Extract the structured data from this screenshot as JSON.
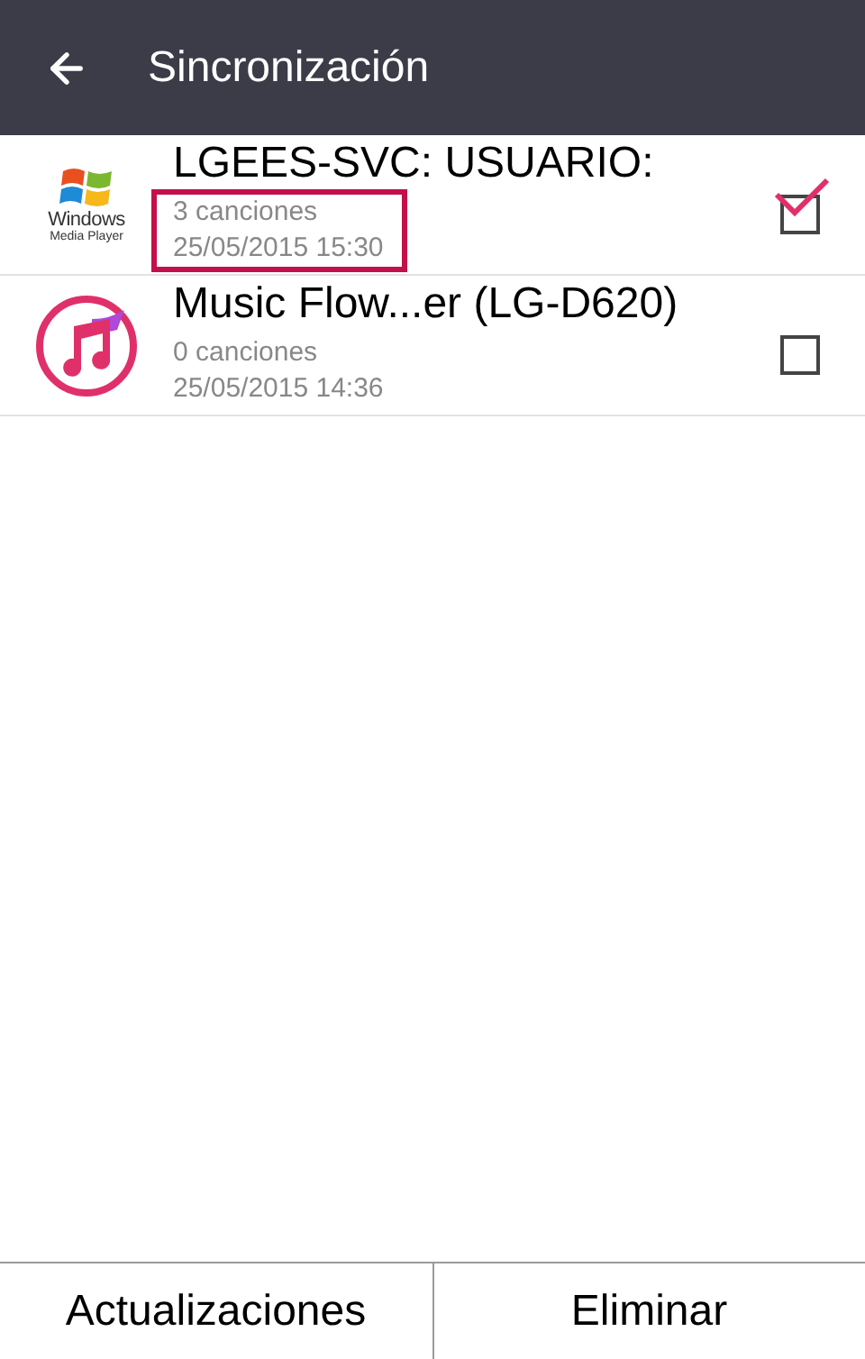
{
  "header": {
    "title": "Sincronización"
  },
  "items": [
    {
      "kind": "wmp",
      "logo_lines": [
        "Windows",
        "Media Player"
      ],
      "name": "LGEES-SVC: USUARIO:",
      "count": "3 canciones",
      "date": "25/05/2015 15:30",
      "checked": true,
      "highlighted": true
    },
    {
      "kind": "music",
      "name": "Music Flow...er (LG-D620)",
      "count": "0 canciones",
      "date": "25/05/2015 14:36",
      "checked": false,
      "highlighted": false
    }
  ],
  "buttons": [
    "Actualizaciones",
    "Eliminar"
  ]
}
